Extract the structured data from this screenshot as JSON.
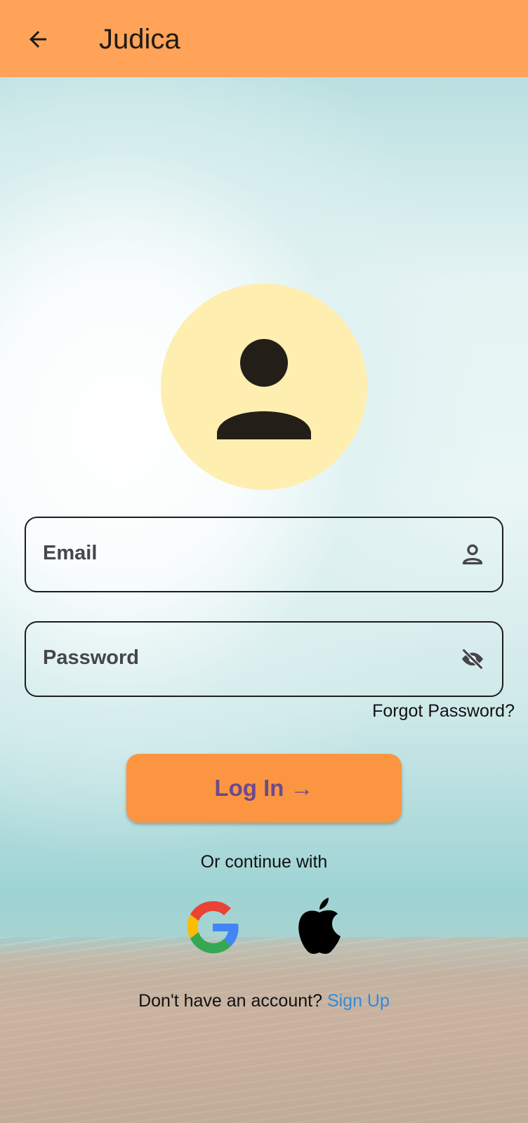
{
  "app_bar": {
    "title": "Judica",
    "back_icon": "arrow-left-icon",
    "background_color": "#fea357"
  },
  "avatar": {
    "icon": "person-icon",
    "background_color": "#feeeaf"
  },
  "email_field": {
    "label": "Email",
    "icon": "person-outline-icon"
  },
  "password_field": {
    "label": "Password",
    "icon": "eye-off-icon"
  },
  "forgot_password": "Forgot Password?",
  "login_button": {
    "label": "Log In →",
    "background_color": "#fc9541",
    "text_color": "#6b4a8e"
  },
  "continue_with": "Or continue with",
  "social": {
    "google_icon": "google-icon",
    "apple_icon": "apple-icon"
  },
  "signup": {
    "prompt": "Don't have an account?",
    "link": "Sign Up",
    "link_color": "#2f8bdc"
  }
}
